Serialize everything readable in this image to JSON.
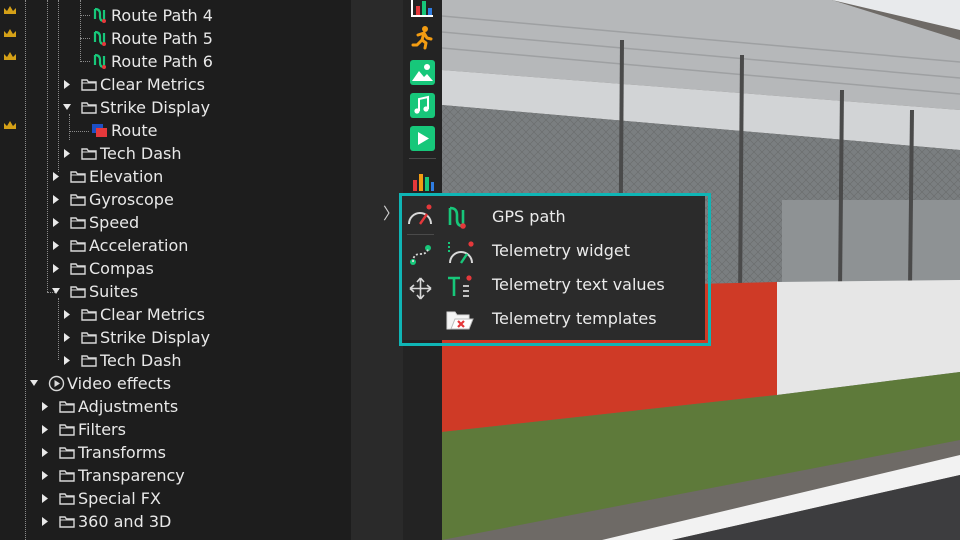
{
  "tree": {
    "rows": [
      {
        "label": "Route Path 4",
        "icon": "route-path-icon"
      },
      {
        "label": "Route Path 5",
        "icon": "route-path-icon"
      },
      {
        "label": "Route Path 6",
        "icon": "route-path-icon"
      },
      {
        "label": "Clear Metrics",
        "icon": "folder-icon",
        "expanded": false
      },
      {
        "label": "Strike Display",
        "icon": "folder-icon",
        "expanded": true
      },
      {
        "label": "Route",
        "icon": "route-icon"
      },
      {
        "label": "Tech Dash",
        "icon": "folder-icon",
        "expanded": false
      },
      {
        "label": "Elevation",
        "icon": "folder-icon",
        "expanded": false
      },
      {
        "label": "Gyroscope",
        "icon": "folder-icon",
        "expanded": false
      },
      {
        "label": "Speed",
        "icon": "folder-icon",
        "expanded": false
      },
      {
        "label": "Acceleration",
        "icon": "folder-icon",
        "expanded": false
      },
      {
        "label": "Compas",
        "icon": "folder-icon",
        "expanded": false
      },
      {
        "label": "Suites",
        "icon": "folder-icon",
        "expanded": true
      },
      {
        "label": "Clear Metrics",
        "icon": "folder-icon",
        "expanded": false
      },
      {
        "label": "Strike Display",
        "icon": "folder-icon",
        "expanded": false
      },
      {
        "label": "Tech Dash",
        "icon": "folder-icon",
        "expanded": false
      },
      {
        "label": "Video effects",
        "icon": "video-effects-icon",
        "expanded": true
      },
      {
        "label": "Adjustments",
        "icon": "folder-icon",
        "expanded": false
      },
      {
        "label": "Filters",
        "icon": "folder-icon",
        "expanded": false
      },
      {
        "label": "Transforms",
        "icon": "folder-icon",
        "expanded": false
      },
      {
        "label": "Transparency",
        "icon": "folder-icon",
        "expanded": false
      },
      {
        "label": "Special FX",
        "icon": "folder-icon",
        "expanded": false
      },
      {
        "label": "360 and 3D",
        "icon": "folder-icon",
        "expanded": false
      }
    ]
  },
  "toolbar": {
    "buttons": [
      "chart-icon",
      "runner-icon",
      "image-icon",
      "music-icon",
      "play-icon",
      "audio-levels-icon",
      "telemetry-icon",
      "path-nodes-icon",
      "move-icon"
    ]
  },
  "menu": {
    "items": [
      {
        "label": "GPS path",
        "icon": "gps-path-icon"
      },
      {
        "label": "Telemetry widget",
        "icon": "telemetry-widget-icon"
      },
      {
        "label": "Telemetry text values",
        "icon": "telemetry-text-icon"
      },
      {
        "label": "Telemetry templates",
        "icon": "telemetry-templates-icon"
      }
    ]
  },
  "colors": {
    "highlight": "#0fb5b5",
    "green": "#17c77a",
    "red": "#e5383b",
    "orange": "#f39c12"
  }
}
